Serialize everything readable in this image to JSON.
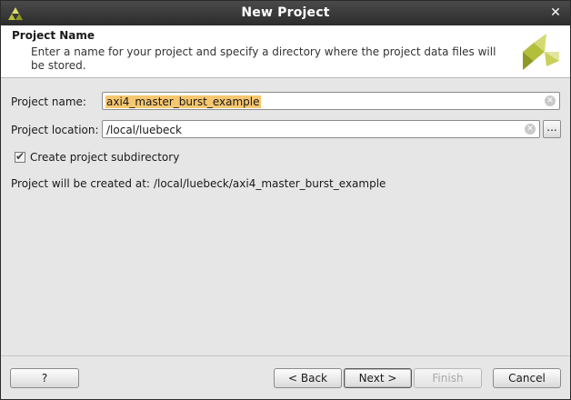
{
  "window": {
    "title": "New Project",
    "close_glyph": "✕"
  },
  "header": {
    "title": "Project Name",
    "description": "Enter a name for your project and specify a directory where the project data files will be stored."
  },
  "form": {
    "name_label": "Project name:",
    "name_value": "axi4_master_burst_example",
    "location_label": "Project location:",
    "location_value": "/local/luebeck",
    "browse_label": "...",
    "subdir_checked": true,
    "subdir_label": "Create project subdirectory",
    "created_at_label": "Project will be created at:",
    "created_at_path": "/local/luebeck/axi4_master_burst_example"
  },
  "buttons": {
    "help": "?",
    "back": "< Back",
    "next": "Next >",
    "finish": "Finish",
    "cancel": "Cancel"
  },
  "icons": {
    "app": "xilinx-logo-icon",
    "header_logo": "xilinx-logo-icon",
    "clear": "clear-field-icon",
    "checkbox": "checkmark-icon"
  },
  "colors": {
    "title_bar": "#333333",
    "selection": "#f6c770",
    "logo_green": "#9aa72a"
  }
}
